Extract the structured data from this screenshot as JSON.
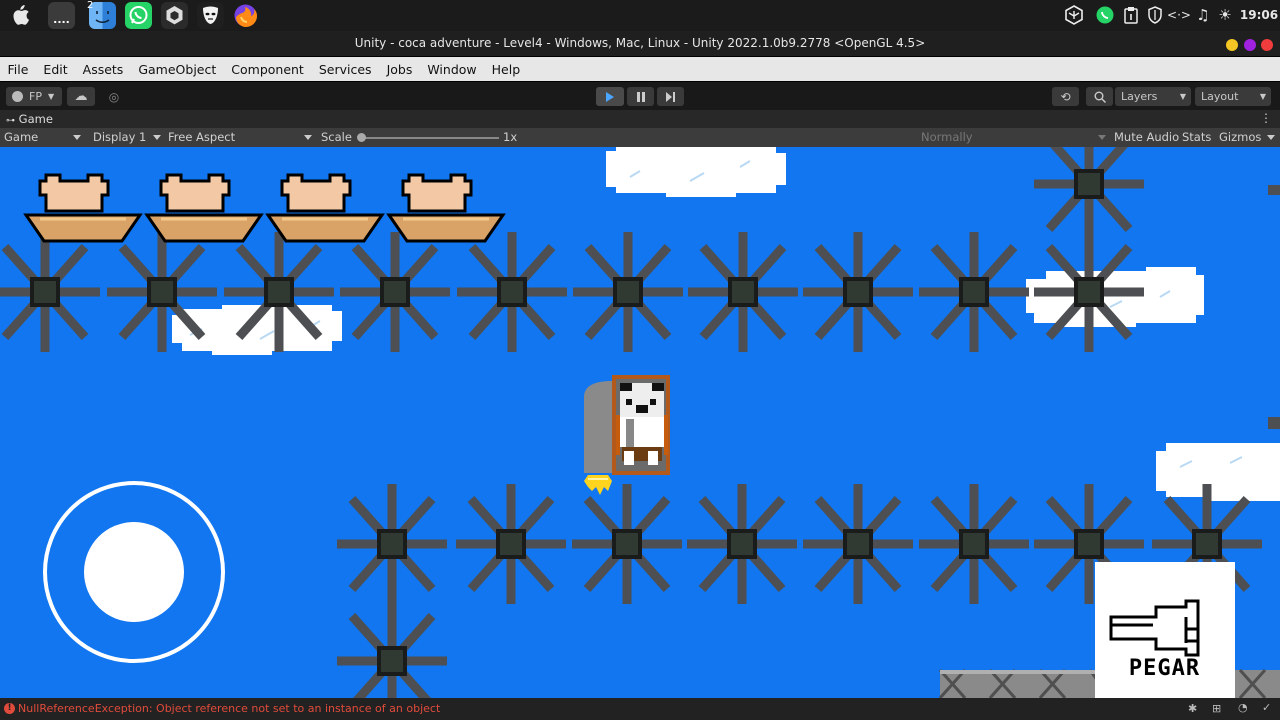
{
  "dock": {
    "apps": [
      {
        "name": "apple-menu",
        "color": "#1b1b1b"
      },
      {
        "name": "terminal",
        "label": "....",
        "color": "#3b3b3b"
      },
      {
        "name": "finder",
        "badge": "2",
        "color": "#3a8ee6"
      },
      {
        "name": "whatsapp",
        "color": "#25d366"
      },
      {
        "name": "unity-hub",
        "color": "#d0d0d0"
      },
      {
        "name": "mask-app",
        "color": "#2a2a2a"
      },
      {
        "name": "firefox",
        "color": "#e66000"
      }
    ],
    "tray_icons": [
      "unity-icon",
      "whatsapp-icon",
      "clipboard-icon",
      "shield-icon",
      "code-icon",
      "music-icon",
      "brightness-icon"
    ],
    "clock": "19:06"
  },
  "window": {
    "title": "Unity - coca adventure - Level4 - Windows, Mac, Linux - Unity 2022.1.0b9.2778 <OpenGL 4.5>",
    "buttons": [
      {
        "name": "minimize",
        "color": "#f3c623"
      },
      {
        "name": "maximize",
        "color": "#a021e0"
      },
      {
        "name": "close",
        "color": "#f03c3c"
      }
    ]
  },
  "menu": [
    "File",
    "Edit",
    "Assets",
    "GameObject",
    "Component",
    "Services",
    "Jobs",
    "Window",
    "Help"
  ],
  "toolbar": {
    "account_label": "FP",
    "layers_label": "Layers",
    "layout_label": "Layout"
  },
  "game_tab": {
    "title": "Game",
    "view_select": "Game",
    "display_select": "Display 1",
    "aspect_select": "Free Aspect",
    "scale_label": "Scale",
    "scale_value": "1x",
    "play_focus": "Normally",
    "mute_audio": "Mute Audio",
    "stats": "Stats",
    "gizmos": "Gizmos"
  },
  "game": {
    "lives": 4,
    "action_button_label": "PEGAR",
    "sky_color": "#1176f0"
  },
  "console": {
    "message": "NullReferenceException: Object reference not set to an instance of an object"
  }
}
